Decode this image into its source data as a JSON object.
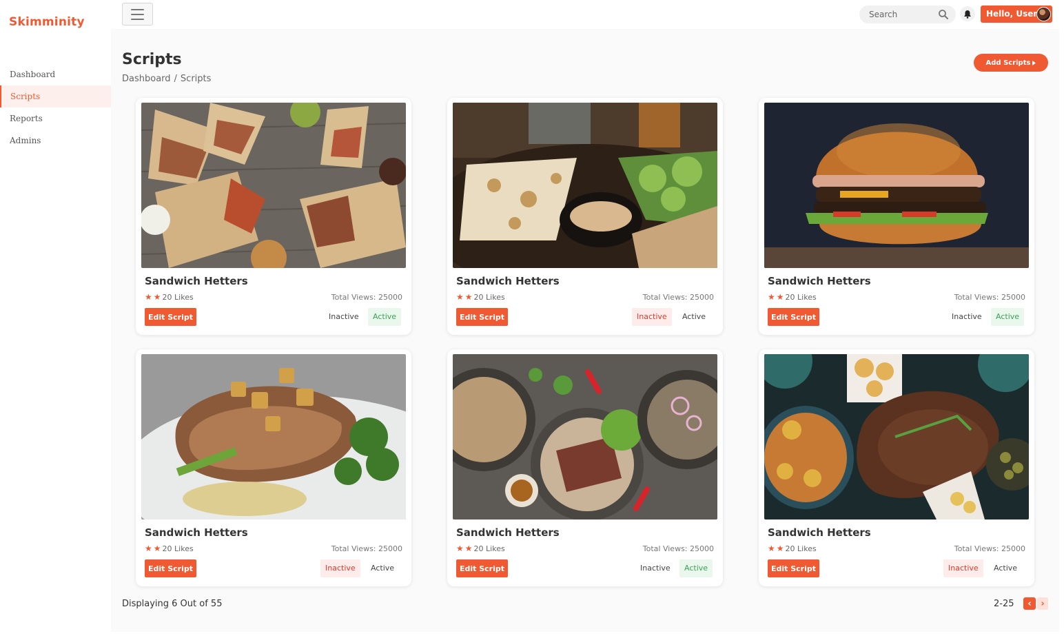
{
  "app": {
    "name": "Skimminity"
  },
  "sidebar": {
    "items": [
      {
        "label": "Dashboard",
        "active": false
      },
      {
        "label": "Scripts",
        "active": true
      },
      {
        "label": "Reports",
        "active": false
      },
      {
        "label": "Admins",
        "active": false
      }
    ]
  },
  "header": {
    "search_placeholder": "Search",
    "user_greeting": "Hello, User"
  },
  "page": {
    "title": "Scripts",
    "breadcrumb": [
      "Dashboard",
      "Scripts"
    ],
    "breadcrumb_sep": "/",
    "add_button": "Add Scripts"
  },
  "cards": [
    {
      "title": "Sandwich Hetters",
      "likes": "20 Likes",
      "views": "Total Views: 25000",
      "edit": "Edit Script",
      "inactive": "Inactive",
      "active": "Active",
      "status": "active",
      "image": "wraps"
    },
    {
      "title": "Sandwich Hetters",
      "likes": "20 Likes",
      "views": "Total Views: 25000",
      "edit": "Edit Script",
      "inactive": "Inactive",
      "active": "Active",
      "status": "inactive",
      "image": "grilled-squid-salad"
    },
    {
      "title": "Sandwich Hetters",
      "likes": "20 Likes",
      "views": "Total Views: 25000",
      "edit": "Edit Script",
      "inactive": "Inactive",
      "active": "Active",
      "status": "active",
      "image": "burger"
    },
    {
      "title": "Sandwich Hetters",
      "likes": "20 Likes",
      "views": "Total Views: 25000",
      "edit": "Edit Script",
      "inactive": "Inactive",
      "active": "Active",
      "status": "inactive",
      "image": "pork-chop"
    },
    {
      "title": "Sandwich Hetters",
      "likes": "20 Likes",
      "views": "Total Views: 25000",
      "edit": "Edit Script",
      "inactive": "Inactive",
      "active": "Active",
      "status": "active",
      "image": "steak-bowls"
    },
    {
      "title": "Sandwich Hetters",
      "likes": "20 Likes",
      "views": "Total Views: 25000",
      "edit": "Edit Script",
      "inactive": "Inactive",
      "active": "Active",
      "status": "inactive",
      "image": "roast-feast"
    }
  ],
  "footer": {
    "displaying": "Displaying 6 Out of 55",
    "range": "2-25"
  },
  "colors": {
    "accent": "#f05a33",
    "inactive_bg": "#fdecea",
    "active_bg": "#eaf7ec"
  },
  "icons": [
    "hamburger-icon",
    "search-icon",
    "bell-icon",
    "avatar",
    "star-icon",
    "caret-right-icon",
    "chevron-left-icon",
    "chevron-right-icon"
  ]
}
